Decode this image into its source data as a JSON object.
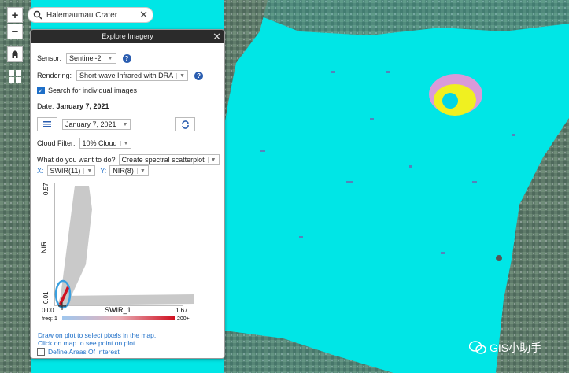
{
  "search": {
    "value": "Halemaumau Crater"
  },
  "controls": {
    "zoom_in": "+",
    "zoom_out": "−"
  },
  "panel": {
    "title": "Explore Imagery",
    "sensor_label": "Sensor:",
    "sensor_value": "Sentinel-2",
    "rendering_label": "Rendering:",
    "rendering_value": "Short-wave Infrared with DRA",
    "search_individual_label": "Search for individual images",
    "date_label": "Date:",
    "date_value": "January 7, 2021",
    "date_select": "January 7, 2021",
    "cloud_label": "Cloud Filter:",
    "cloud_value": "10% Cloud",
    "task_label": "What do you want to do?",
    "task_value": "Create spectral scatterplot",
    "x_label": "X:",
    "x_value": "SWIR(11)",
    "y_label": "Y:",
    "y_value": "NIR(8)"
  },
  "chart_data": {
    "type": "scatter",
    "xlabel": "SWIR_1",
    "ylabel": "NIR",
    "x_ticks": [
      "0.00",
      "1.67"
    ],
    "y_ticks": [
      "0.01",
      "0.57"
    ],
    "xlim": [
      0.0,
      1.67
    ],
    "ylim": [
      0.01,
      0.57
    ],
    "legend_min": "freq: 1",
    "legend_max": "200+",
    "colors": {
      "points": "#c9c9c9",
      "dense": "#d01020",
      "selection": "#3aa0e0"
    }
  },
  "hints": {
    "draw": "Draw on plot to select pixels in the map.",
    "click": "Click on map to see point on plot.",
    "define_aoi": "Define Areas Of Interest"
  },
  "watermark": {
    "text": "GIS小助手"
  },
  "colors": {
    "water": "#00e6e6",
    "panel_header": "#2b2b2b",
    "accent": "#1e6fc8"
  }
}
